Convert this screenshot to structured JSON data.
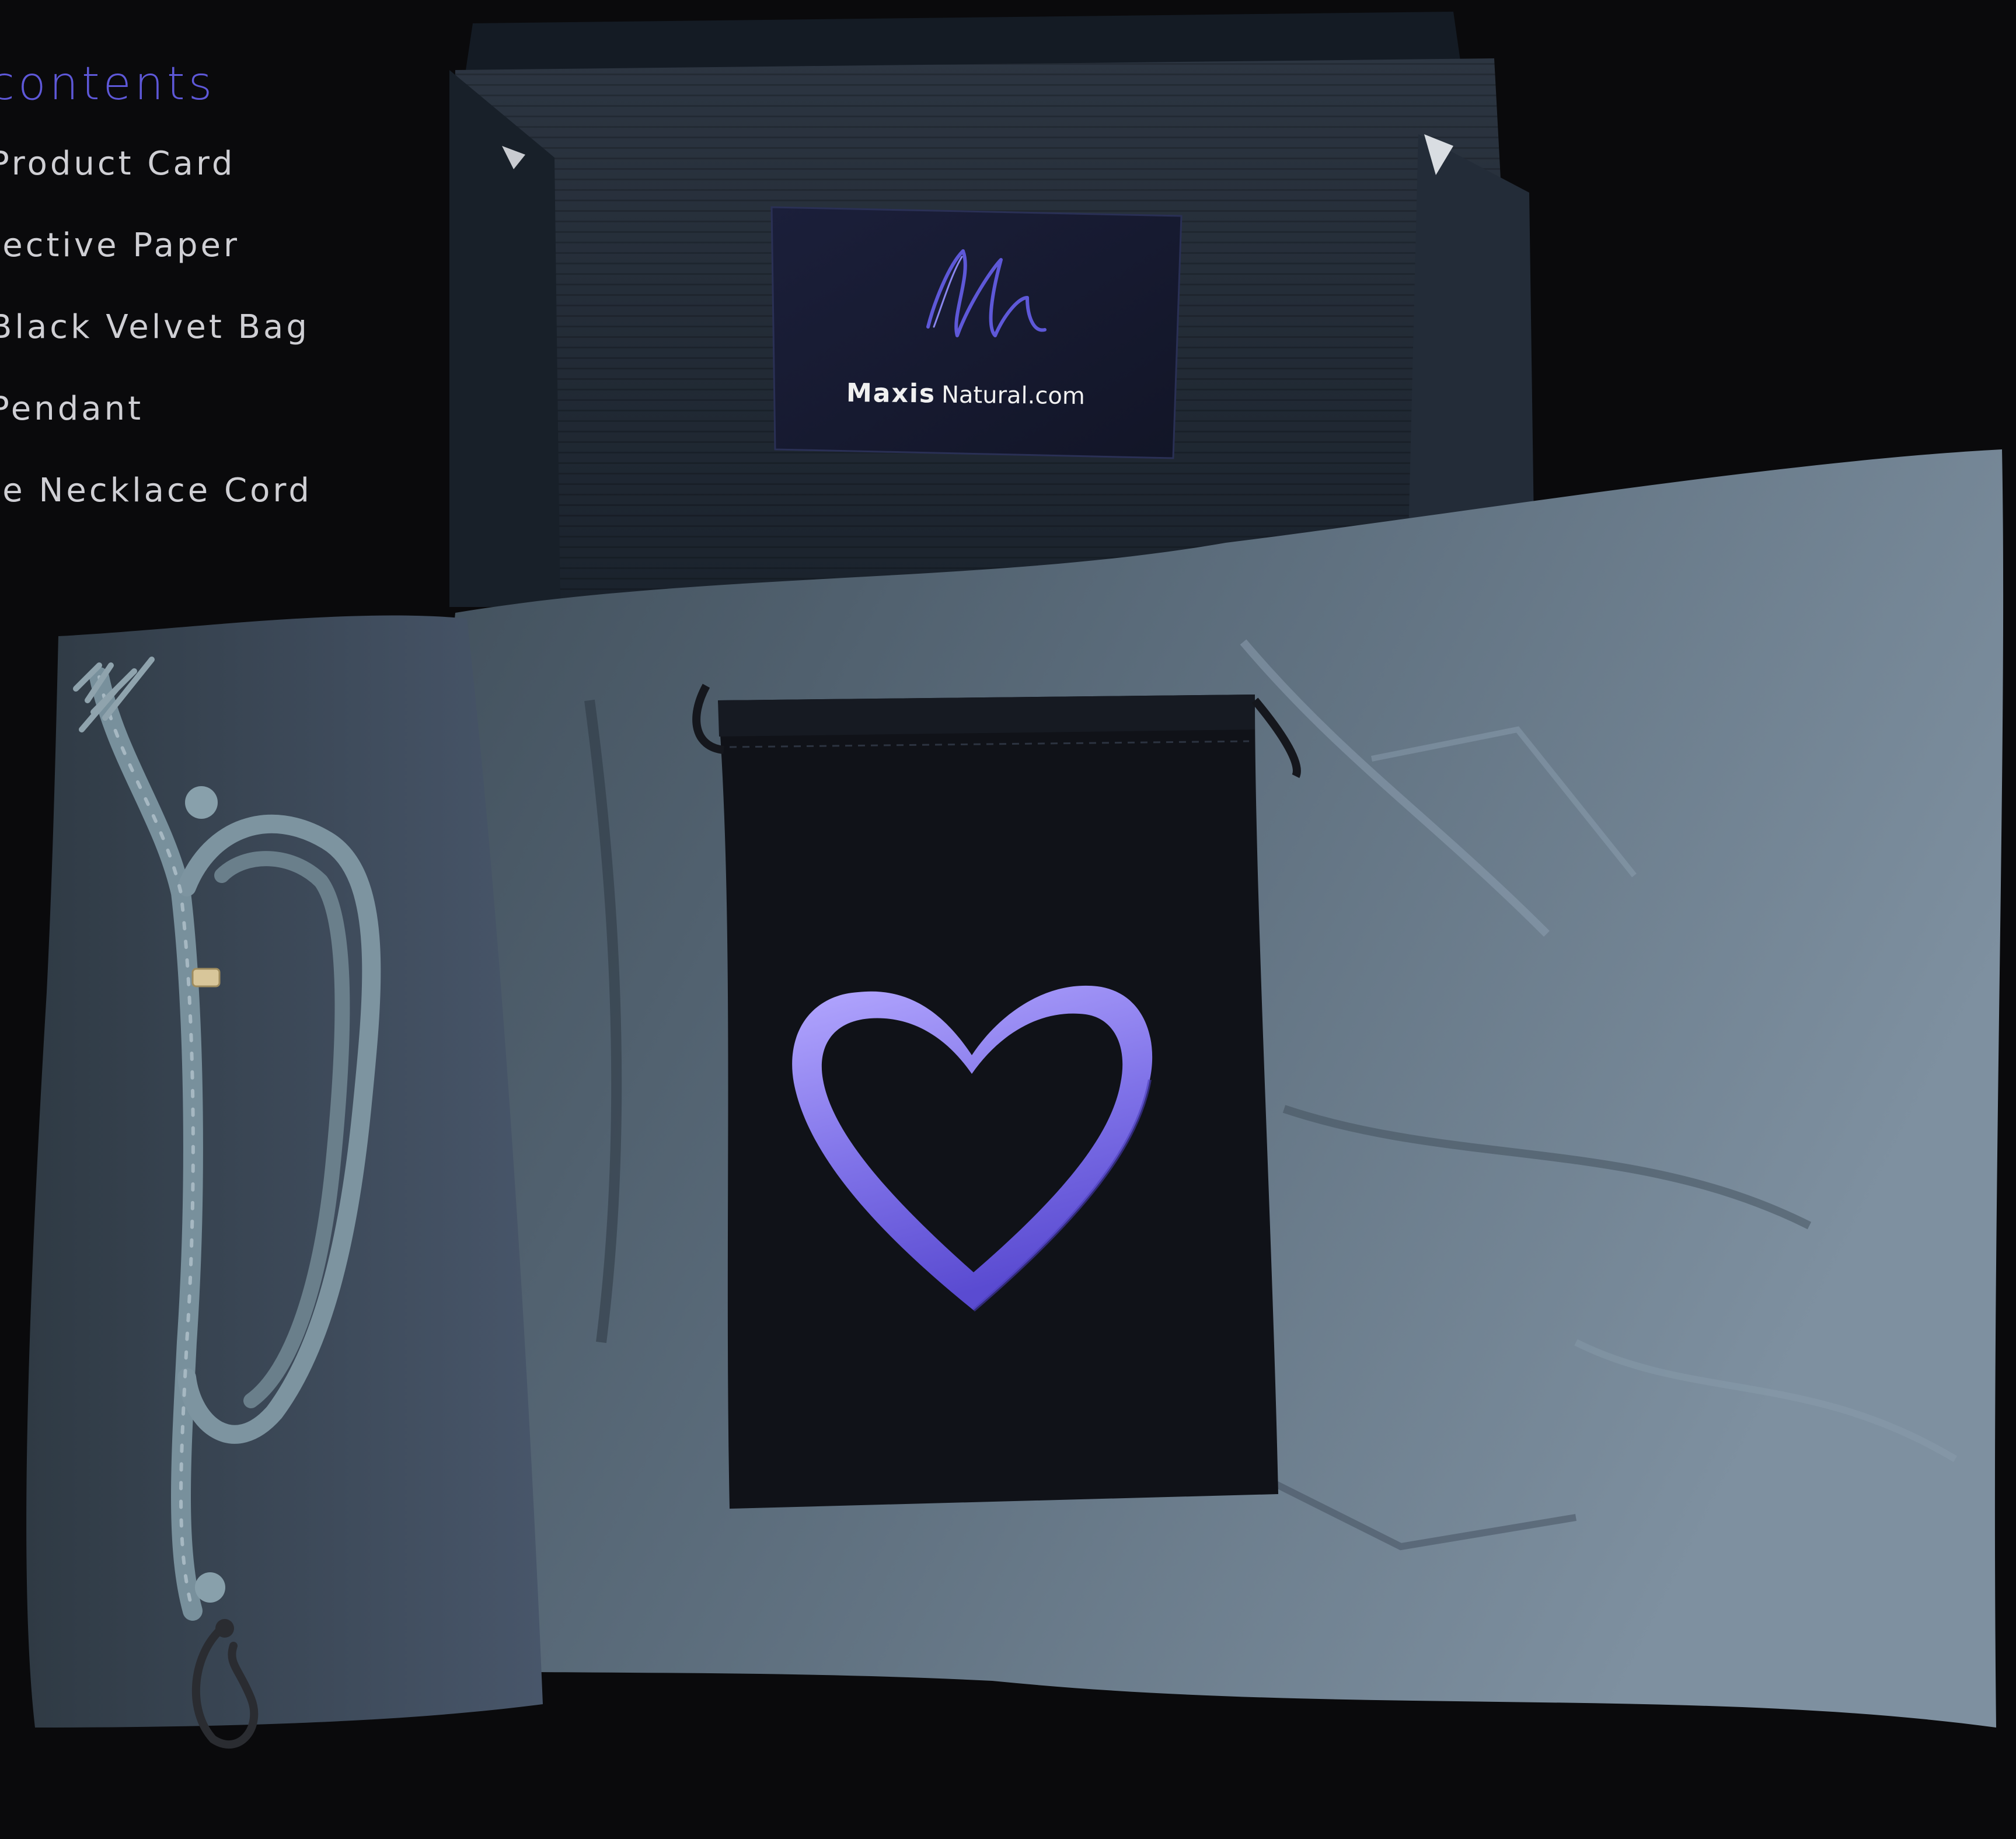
{
  "contents": {
    "title": "contents",
    "items": [
      "Product Card",
      "otective Paper",
      "Black Velvet Bag",
      "Pendant",
      "ate Necklace Cord"
    ]
  },
  "card": {
    "brand_main": "Maxis",
    "brand_rest": "Natural.com",
    "monogram": "m"
  },
  "colors": {
    "accent": "#5e58d8",
    "text": "#cfcfd4",
    "pendant": "#8a7ff2",
    "paper": "#5b6c7b",
    "box": "#1f2732",
    "bag": "#111318"
  }
}
